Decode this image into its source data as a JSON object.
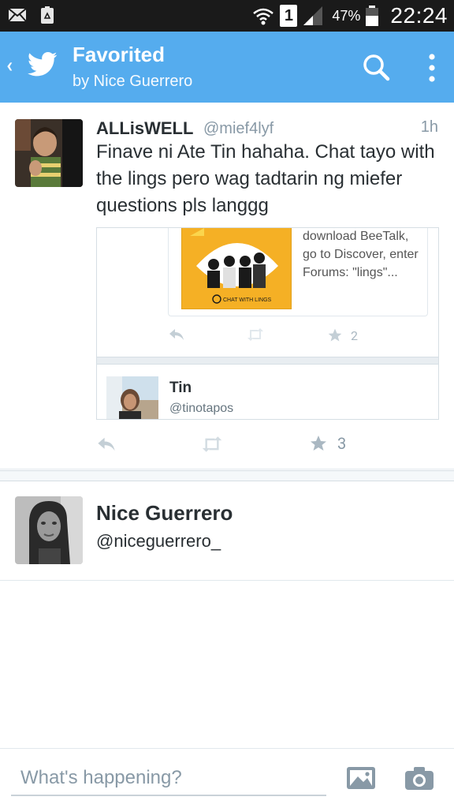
{
  "status_bar": {
    "left_icons": [
      "mail-icon",
      "recycle-battery-icon"
    ],
    "right_icons": [
      "wifi-icon",
      "sim-1-icon",
      "signal-icon",
      "battery-icon"
    ],
    "sim_label": "1",
    "battery_percent": "47%",
    "time": "22:24"
  },
  "app_bar": {
    "back_icon": "chevron-left-icon",
    "logo": "twitter-bird-icon",
    "title": "Favorited",
    "subtitle": "by Nice Guerrero",
    "actions": [
      "search-icon",
      "overflow-menu-icon"
    ]
  },
  "tweet": {
    "name": "ALLisWELL",
    "handle": "@mief4lyf",
    "time": "1h",
    "text": "Finave ni Ate Tin hahaha. Chat tayo with the lings pero wag tadtarin ng miefer questions pls langgg",
    "quoted": {
      "image_caption": "CHAT WITH LINGS",
      "text": "download BeeTalk, go to Discover, enter Forums: \"lings\"...",
      "fav_count": "2",
      "user_name": "Tin",
      "user_handle": "@tinotapos"
    },
    "fav_count": "3"
  },
  "user": {
    "name": "Nice Guerrero",
    "handle": "@niceguerrero_"
  },
  "composer": {
    "placeholder": "What's happening?",
    "actions": [
      "photo-icon",
      "camera-icon"
    ]
  },
  "colors": {
    "brand_blue": "#55acee",
    "status_bar": "#1a1a1a",
    "muted_text": "#8899a6",
    "card_yellow": "#f5b025"
  }
}
